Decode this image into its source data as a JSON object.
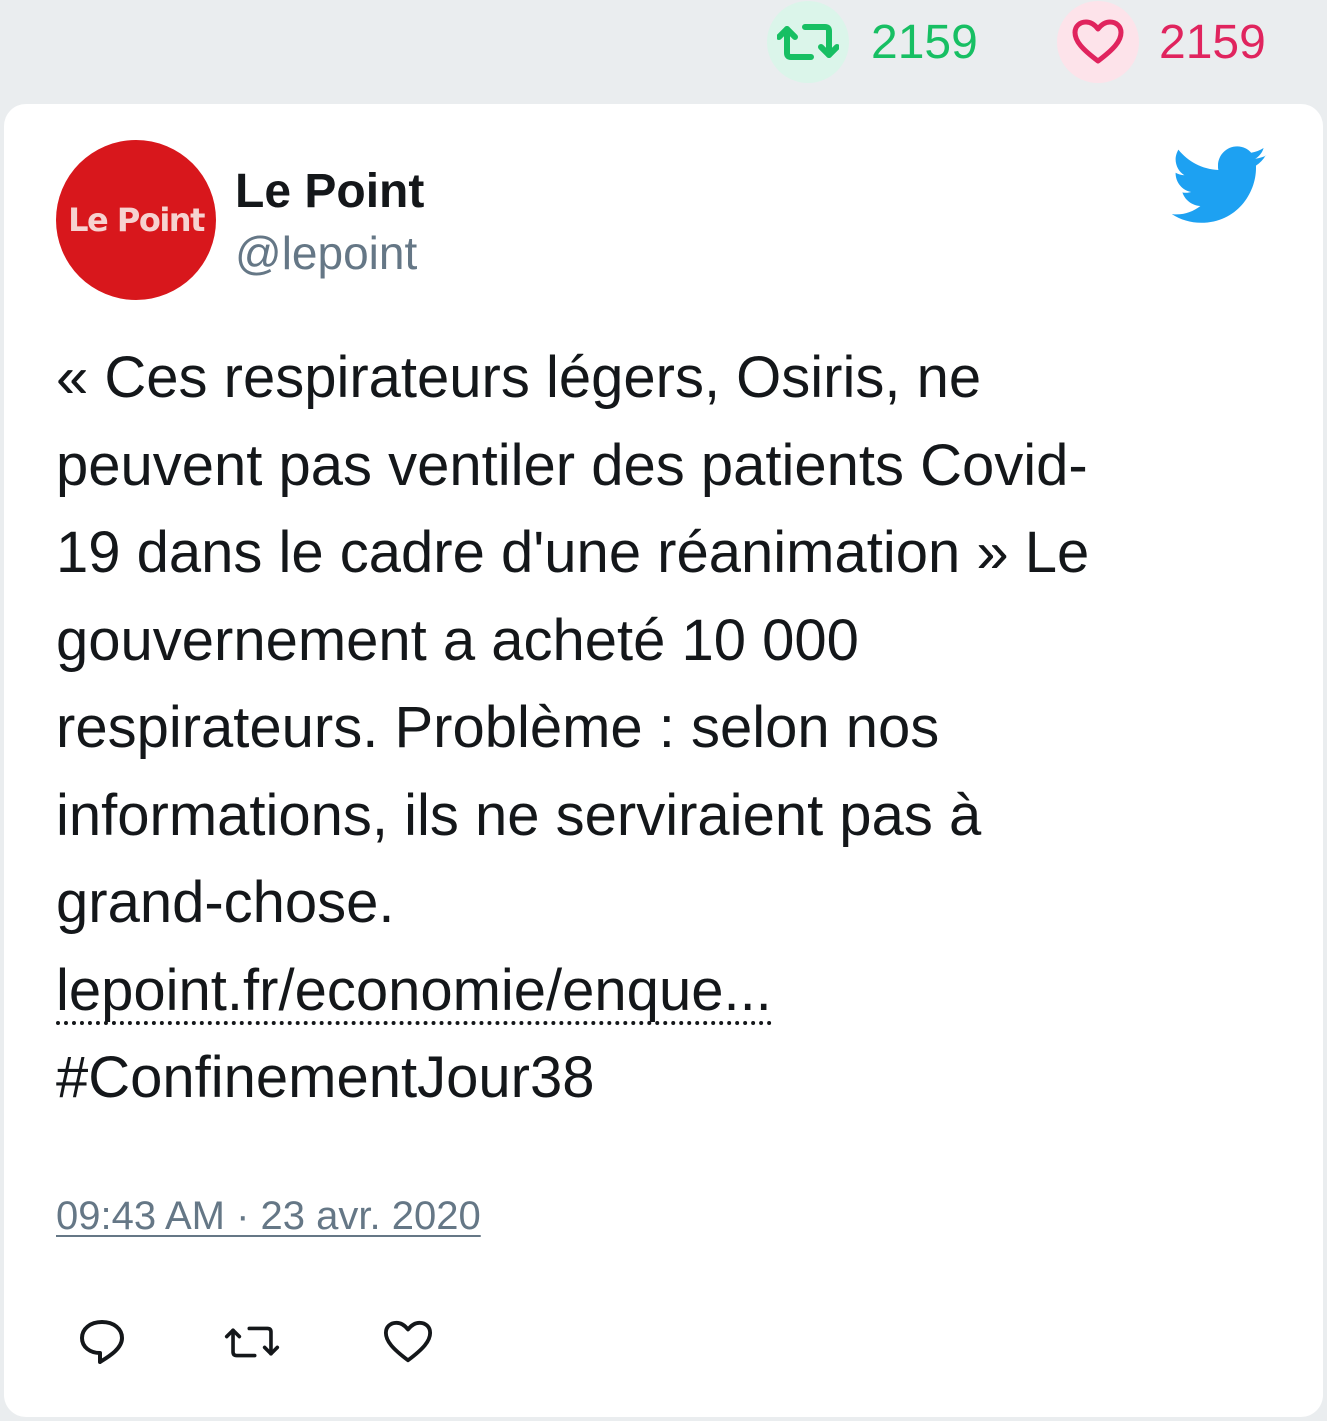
{
  "stats": {
    "retweet_count": "2159",
    "like_count": "2159",
    "retweet_icon": "retweet-icon",
    "like_icon": "heart-icon"
  },
  "tweet": {
    "avatar_text": "Le Point",
    "display_name": "Le Point",
    "handle": "@lepoint",
    "body_lines": [
      "« Ces respirateurs légers, Osiris, ne",
      "peuvent pas ventiler des patients Covid-",
      "19 dans le cadre d'une réanimation » Le",
      "gouvernement a acheté 10 000",
      "respirateurs. Problème : selon nos",
      "informations, ils ne serviraient pas à",
      "grand-chose."
    ],
    "link_text": "lepoint.fr/economie/enque...",
    "hashtag": "#ConfinementJour38",
    "timestamp": "09:43 AM · 23 avr. 2020"
  },
  "actions": [
    "reply-icon",
    "retweet-icon",
    "heart-icon"
  ],
  "colors": {
    "background": "#eaedef",
    "retweet_green": "#17bf63",
    "like_red": "#e0245e",
    "twitter_blue": "#1da1f2",
    "avatar_red": "#d8171c",
    "secondary_text": "#657786"
  }
}
